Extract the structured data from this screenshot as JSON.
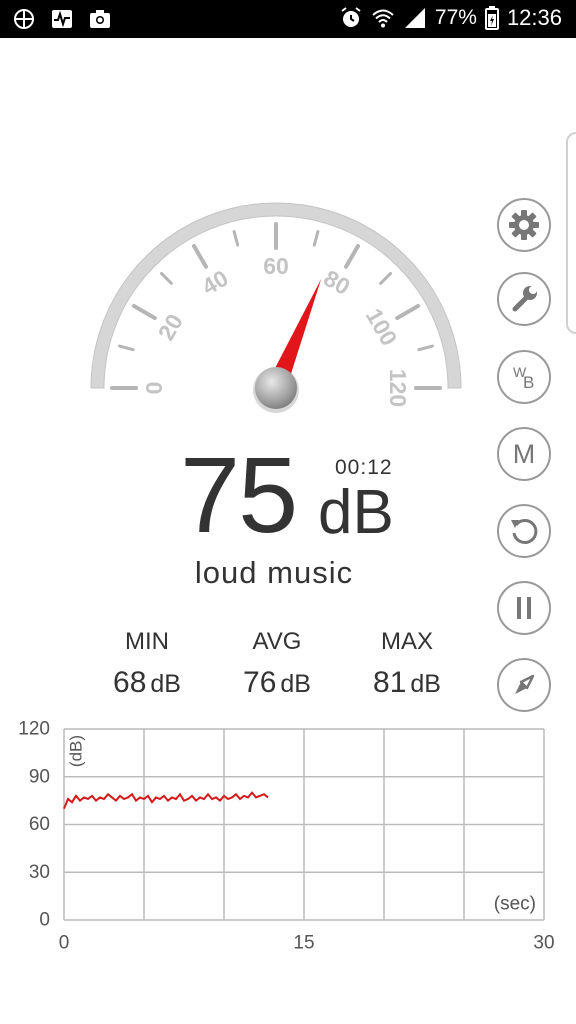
{
  "status_bar": {
    "left_icons": [
      "crosshair-icon",
      "activity-icon",
      "camera-icon"
    ],
    "battery": "77%",
    "time": "12:36"
  },
  "gauge": {
    "tick_labels": [
      "0",
      "20",
      "40",
      "60",
      "80",
      "100",
      "120"
    ],
    "min": 0,
    "max": 120,
    "needle_value": 75,
    "needle_color": "#e0161b"
  },
  "reading": {
    "value": "75",
    "unit": "dB",
    "timer": "00:12",
    "description": "loud music"
  },
  "stats": {
    "min_label": "MIN",
    "min_value": "68",
    "min_unit": "dB",
    "avg_label": "AVG",
    "avg_value": "76",
    "avg_unit": "dB",
    "max_label": "MAX",
    "max_value": "81",
    "max_unit": "dB"
  },
  "side_buttons": [
    "gear-icon",
    "wrench-icon",
    "white-balance-icon",
    "m-icon",
    "reset-icon",
    "pause-icon",
    "compass-icon"
  ],
  "side_labels": {
    "wb_w": "W",
    "wb_b": "B",
    "m": "M"
  },
  "chart_data": {
    "type": "line",
    "ylabel": "(dB)",
    "xlabel": "(sec)",
    "y_ticks": [
      "120",
      "90",
      "60",
      "30",
      "0"
    ],
    "x_ticks": [
      "0",
      "15",
      "30"
    ],
    "ylim": [
      0,
      120
    ],
    "xlim": [
      0,
      30
    ],
    "grid": true,
    "series": [
      {
        "color": "#d41a1a",
        "x": [
          0,
          0.25,
          0.5,
          0.75,
          1,
          1.25,
          1.5,
          1.75,
          2,
          2.25,
          2.5,
          2.75,
          3,
          3.25,
          3.5,
          3.75,
          4,
          4.25,
          4.5,
          4.75,
          5,
          5.25,
          5.5,
          5.75,
          6,
          6.25,
          6.5,
          6.75,
          7,
          7.25,
          7.5,
          7.75,
          8,
          8.25,
          8.5,
          8.75,
          9,
          9.25,
          9.5,
          9.75,
          10,
          10.25,
          10.5,
          10.75,
          11,
          11.25,
          11.5,
          11.75,
          12,
          12.25,
          12.5,
          12.75
        ],
        "values": [
          70,
          76,
          74,
          78,
          75,
          77,
          76,
          78,
          75,
          77,
          76,
          79,
          77,
          75,
          78,
          76,
          77,
          79,
          75,
          77,
          76,
          78,
          74,
          77,
          76,
          78,
          75,
          77,
          76,
          79,
          75,
          76,
          78,
          75,
          77,
          76,
          79,
          76,
          77,
          75,
          78,
          76,
          77,
          79,
          76,
          78,
          77,
          80,
          77,
          78,
          79,
          77
        ]
      }
    ]
  }
}
